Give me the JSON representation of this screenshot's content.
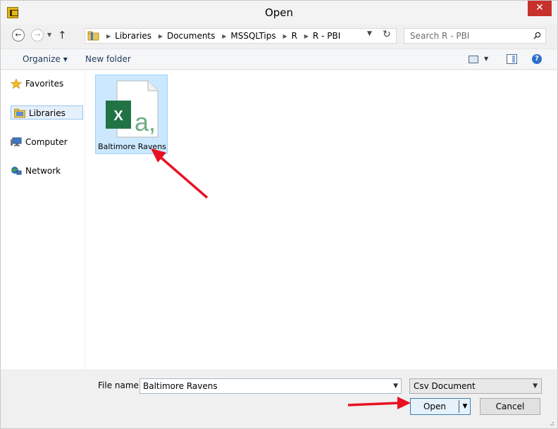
{
  "window": {
    "title": "Open",
    "close_label": "✕"
  },
  "address": {
    "crumbs": [
      "Libraries",
      "Documents",
      "MSSQLTips",
      "R",
      "R - PBI"
    ]
  },
  "search": {
    "placeholder": "Search R - PBI"
  },
  "toolbar": {
    "organize_label": "Organize",
    "new_folder_label": "New folder"
  },
  "sidebar": {
    "items": [
      {
        "label": "Favorites"
      },
      {
        "label": "Libraries",
        "selected": true
      },
      {
        "label": "Computer"
      },
      {
        "label": "Network"
      }
    ]
  },
  "files": [
    {
      "name": "Baltimore Ravens",
      "type_icon": "csv-excel-icon",
      "selected": true
    }
  ],
  "footer": {
    "file_name_label": "File name:",
    "file_name_value": "Baltimore Ravens",
    "file_type_value": "Csv Document",
    "open_label": "Open",
    "cancel_label": "Cancel"
  },
  "colors": {
    "close_red": "#c7302b",
    "selection_blue": "#cce8ff",
    "excel_green": "#217346",
    "arrow_red": "#e81123"
  }
}
